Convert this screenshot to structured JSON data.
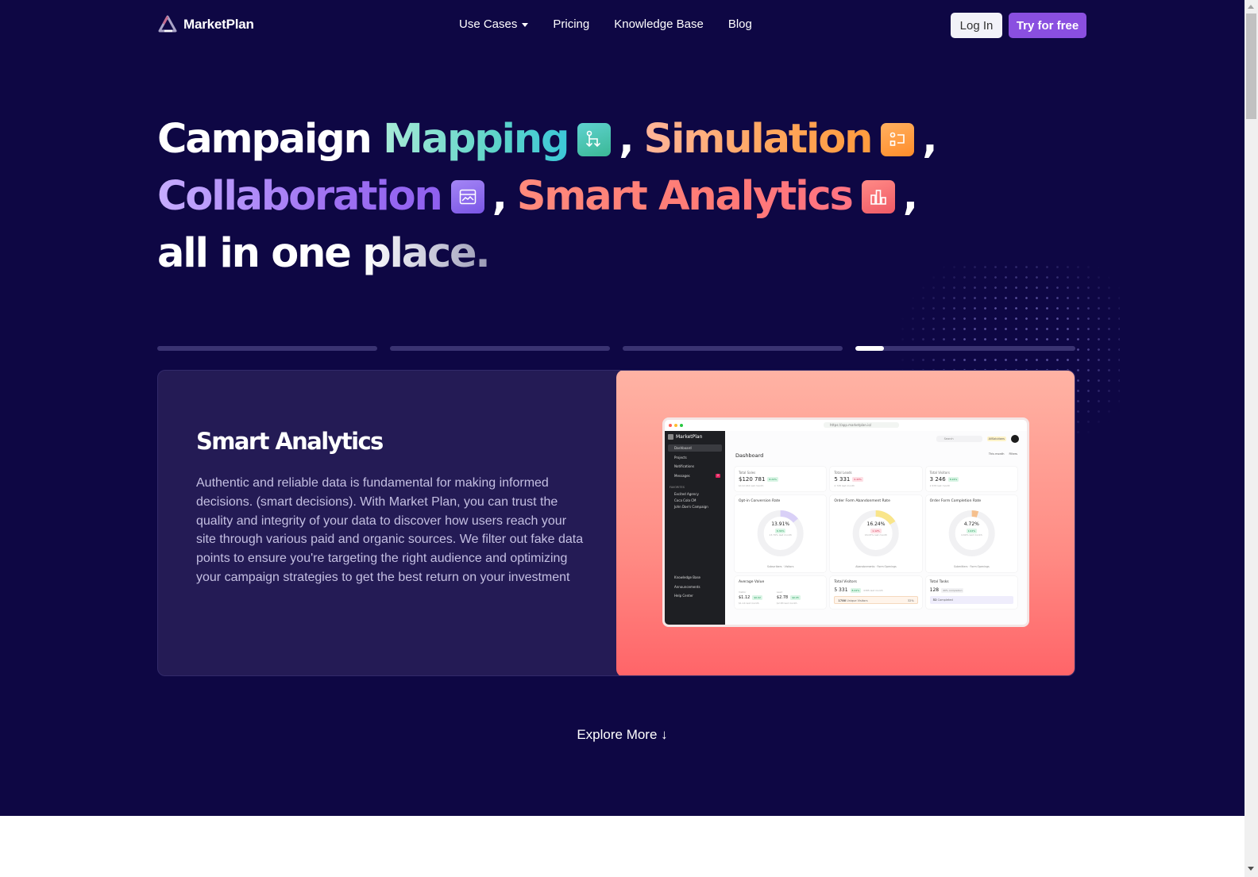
{
  "brand": {
    "name": "MarketPlan",
    "logo_icon": "triangle-logo-icon"
  },
  "nav": {
    "links": [
      {
        "label": "Use Cases",
        "has_dropdown": true
      },
      {
        "label": "Pricing"
      },
      {
        "label": "Knowledge Base"
      },
      {
        "label": "Blog"
      }
    ],
    "login_label": "Log In",
    "cta_label": "Try for free"
  },
  "headline": {
    "line1": {
      "a": "Campaign",
      "b": "Mapping",
      "c": ",",
      "d": "Simulation",
      "e": ","
    },
    "line2": {
      "a": "Collaboration",
      "b": ",",
      "c": "Smart Analytics",
      "d": ","
    },
    "line3": {
      "a": "all in one",
      "b": "place."
    },
    "icons": [
      "branch-arrows-icon",
      "flow-blocks-icon",
      "window-chart-icon",
      "bar-chart-icon"
    ]
  },
  "slides": {
    "count": 4,
    "active_index": 3,
    "active_progress_pct": 13
  },
  "feature": {
    "title": "Smart Analytics",
    "body": "Authentic and reliable data is fundamental for making informed decisions. (smart decisions). With Market Plan, you can trust the quality and integrity of your data to discover how users reach your site through various paid and organic sources. We filter out fake data points to ensure you're targeting the right audience and optimizing your campaign strategies to get the best return on your investment"
  },
  "dashboard_preview": {
    "url": "https://app.marketplan.io/",
    "brand": "MarketPlan",
    "sidebar": [
      "Dashboard",
      "Projects",
      "Notifications",
      "Messages"
    ],
    "messages_badge": "2",
    "favorites_label": "FAVORITES",
    "favorites": [
      "Excited Agency",
      "Coca Cola CM",
      "John Doe's Campaign"
    ],
    "bottom_links": [
      "Knowledge Base",
      "Announcements",
      "Help Center"
    ],
    "search_placeholder": "Search",
    "org": "AllSolutions",
    "page_title": "Dashboard",
    "tools": [
      "This month",
      "Filters"
    ],
    "stats": [
      {
        "label": "Total Sales",
        "value": "$120 781",
        "change": "8.24%",
        "direction": "up",
        "sub": "$119 244 last month"
      },
      {
        "label": "Total Leads",
        "value": "5 331",
        "change": "0.43%",
        "direction": "down",
        "sub": "4 728 last month"
      },
      {
        "label": "Total Visitors",
        "value": "3 246",
        "change": "8.24%",
        "direction": "up",
        "sub": "2 678 last month"
      }
    ],
    "rates": [
      {
        "label": "Opt-in Conversion Rate",
        "value": "13.91%",
        "change": "6.34%",
        "direction": "up",
        "sub": "13.76% last month",
        "legend": [
          "Subscribers",
          "Visitors"
        ],
        "fill_pct": 13.91,
        "color": "#d9d0f7"
      },
      {
        "label": "Order Form Abandonment Rate",
        "value": "16.24%",
        "change": "1.12%",
        "direction": "down",
        "sub": "16.03% last month",
        "legend": [
          "Abandonments",
          "Form Openings"
        ],
        "fill_pct": 16.24,
        "color": "#f9e58a"
      },
      {
        "label": "Order Form Completion Rate",
        "value": "4.72%",
        "change": "1.02%",
        "direction": "up",
        "sub": "4.69% last month",
        "legend": [
          "Submitters",
          "Form Openings"
        ],
        "fill_pct": 4.72,
        "color": "#f5c08e"
      }
    ],
    "average_value": {
      "label": "Average Value",
      "visitor_label": "Visitor",
      "visitor_value": "$1.12",
      "visitor_change": "$0.02",
      "visitor_sub": "$1.14 last month",
      "lead_label": "Lead",
      "lead_value": "$2.78",
      "lead_change": "$0.05",
      "lead_sub": "$2.83 last month"
    },
    "total_visitors": {
      "label": "Total Visitors",
      "value": "5 331",
      "change": "8.24%",
      "sub": "4385 last month",
      "unique_count": "1786",
      "unique_label": "Unique Visitors",
      "unique_pct": "32%"
    },
    "total_tasks": {
      "label": "Total Tasks",
      "value": "128",
      "completion": "40% completion",
      "completed_count": "52",
      "completed_label": "Completed"
    }
  },
  "explore": {
    "label": "Explore More",
    "icon": "arrow-down-icon",
    "glyph": "↓"
  }
}
